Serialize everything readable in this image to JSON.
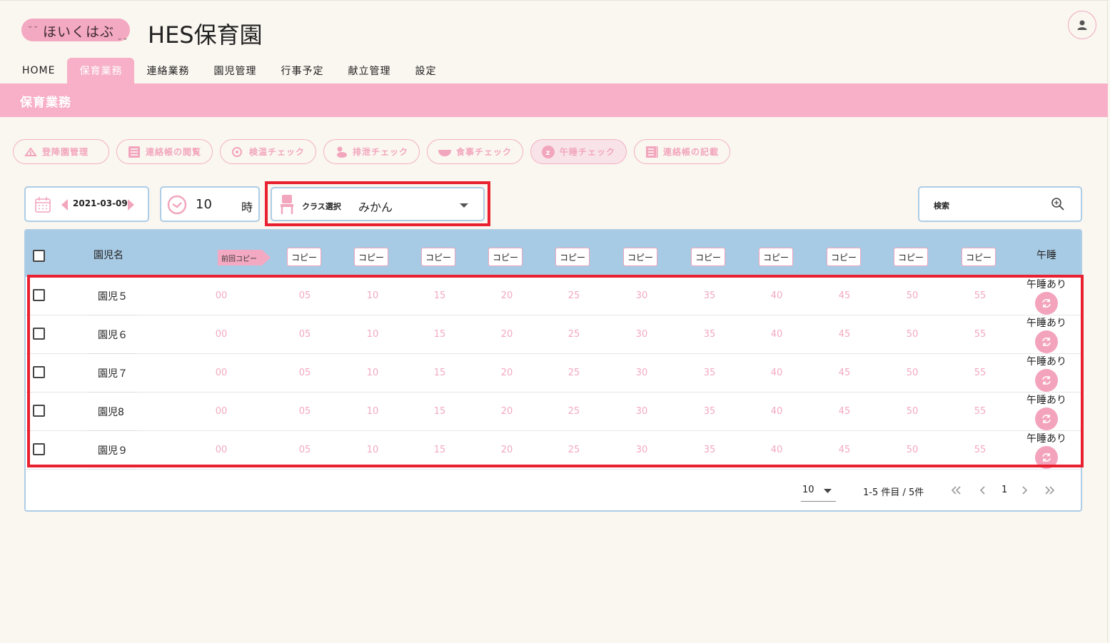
{
  "header": {
    "logo_text": "ほいくはぶ",
    "title": "HES保育園"
  },
  "nav": {
    "items": [
      {
        "label": "HOME",
        "active": false
      },
      {
        "label": "保育業務",
        "active": true
      },
      {
        "label": "連絡業務",
        "active": false
      },
      {
        "label": "園児管理",
        "active": false
      },
      {
        "label": "行事予定",
        "active": false
      },
      {
        "label": "献立管理",
        "active": false
      },
      {
        "label": "設定",
        "active": false
      }
    ]
  },
  "section": {
    "title": "保育業務"
  },
  "actions": [
    {
      "label": "登降園管理",
      "icon": "arrival-icon",
      "active": false
    },
    {
      "label": "連絡帳の閲覧",
      "icon": "list-icon",
      "active": false
    },
    {
      "label": "検温チェック",
      "icon": "thermometer-icon",
      "active": false
    },
    {
      "label": "排泄チェック",
      "icon": "duck-icon",
      "active": false
    },
    {
      "label": "食事チェック",
      "icon": "bowl-icon",
      "active": false
    },
    {
      "label": "午睡チェック",
      "icon": "sleep-icon",
      "active": true
    },
    {
      "label": "連絡帳の記載",
      "icon": "notebook-icon",
      "active": false
    }
  ],
  "controls": {
    "date": "2021-03-09",
    "hour": "10",
    "hour_unit": "時",
    "class_label": "クラス選択",
    "class_value": "みかん",
    "search_label": "検索"
  },
  "table": {
    "name_header": "園児名",
    "prev_copy_label": "前回コピー",
    "copy_label": "コピー",
    "nap_header": "午睡",
    "minutes": [
      "00",
      "05",
      "10",
      "15",
      "20",
      "25",
      "30",
      "35",
      "40",
      "45",
      "50",
      "55"
    ],
    "rows": [
      {
        "name": "園児５",
        "nap_status": "午睡あり"
      },
      {
        "name": "園児６",
        "nap_status": "午睡あり"
      },
      {
        "name": "園児７",
        "nap_status": "午睡あり"
      },
      {
        "name": "園児8",
        "nap_status": "午睡あり"
      },
      {
        "name": "園児９",
        "nap_status": "午睡あり"
      }
    ]
  },
  "pagination": {
    "per_page": "10",
    "range": "1-5 件目 / 5件",
    "page": "1"
  },
  "colors": {
    "accent_pink": "#f7b0c7",
    "table_header_blue": "#a8cbe5",
    "highlight_red": "#e8202f",
    "background": "#faf6f0"
  }
}
